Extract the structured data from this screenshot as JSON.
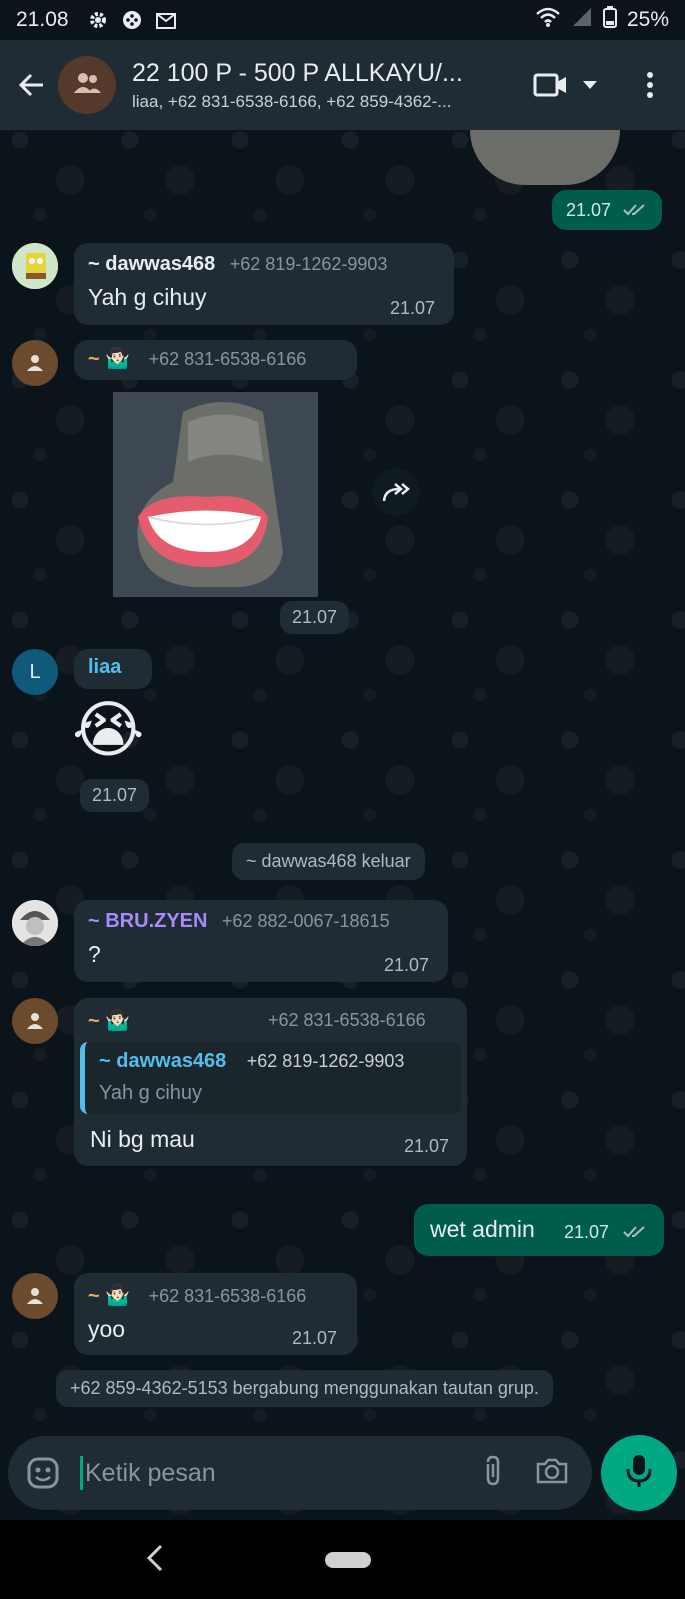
{
  "status_bar": {
    "time": "21.08",
    "battery": "25%",
    "icons": [
      "gear-icon",
      "game-icon",
      "mail-icon",
      "wifi-icon",
      "signal-icon",
      "battery-icon"
    ]
  },
  "header": {
    "title": "22 100 P - 500 P ALLKAYU/...",
    "subtitle": "liaa, +62 831-6538-6166, +62 859-4362-...",
    "icons": [
      "back-arrow-icon",
      "group-icon",
      "video-call-icon",
      "dropdown-icon",
      "more-icon"
    ]
  },
  "messages": {
    "m1": {
      "time": "21.07"
    },
    "m2": {
      "sender": "~ dawwas468",
      "phone": "+62 819-1262-9903",
      "text": "Yah g cihuy",
      "time": "21.07"
    },
    "m3": {
      "sender": "~ 🤷🏻‍♂️",
      "phone": "+62 831-6538-6166",
      "time": "21.07"
    },
    "m4": {
      "sender": "liaa",
      "avatar_letter": "L",
      "emoji": "😭",
      "time": "21.07"
    },
    "sys1": {
      "text": "~ dawwas468 keluar"
    },
    "m5": {
      "sender": "~ BRU.ZYEN",
      "phone": "+62 882-0067-18615",
      "text": "?",
      "time": "21.07"
    },
    "m6": {
      "sender": "~ 🤷🏻‍♂️",
      "phone": "+62 831-6538-6166",
      "quote_sender": "~ dawwas468",
      "quote_phone": "+62 819-1262-9903",
      "quote_text": "Yah g cihuy",
      "text": "Ni bg mau",
      "time": "21.07"
    },
    "m7": {
      "text": "wet admin",
      "time": "21.07"
    },
    "m8": {
      "sender": "~ 🤷🏻‍♂️",
      "phone": "+62 831-6538-6166",
      "text": "yoo",
      "time": "21.07"
    },
    "sys2": {
      "text": "+62 859-4362-5153 bergabung menggunakan tautan grup."
    }
  },
  "input": {
    "placeholder": "Ketik pesan"
  },
  "colors": {
    "header_bg": "#1f2c34",
    "incoming_bubble": "#1f2c34",
    "outgoing_bubble": "#005c4b",
    "accent": "#00a884",
    "sender_dawwas": "#e9edef",
    "sender_liaa": "#53bdeb",
    "sender_bru": "#a78bfa"
  }
}
